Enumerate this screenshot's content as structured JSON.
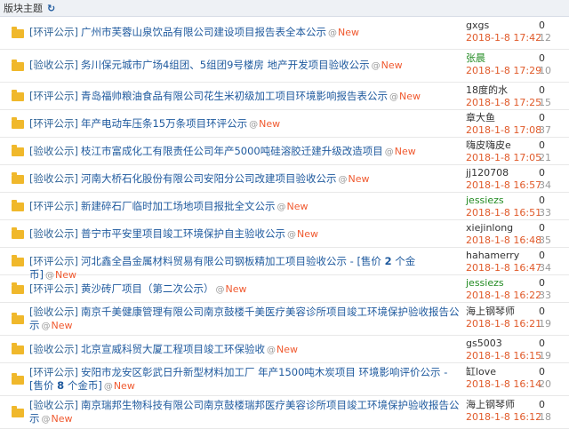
{
  "header": {
    "title": "版块主题",
    "refresh_icon": "refresh-icon"
  },
  "threads": [
    {
      "tag": "[环评公示]",
      "title": "广州市芙蓉山泉饮品有限公司建设项目报告表全本公示",
      "new": "New",
      "author": "gxgs",
      "author_green": false,
      "date": "2018-1-8 17:42",
      "replies": "0",
      "views": "12",
      "size": "tall",
      "lines": 1
    },
    {
      "tag": "[验收公示]",
      "title": "务川保元城市广场4组团、5组团9号楼房 地产开发项目验收公示",
      "new": "New",
      "author": "张晨",
      "author_green": true,
      "date": "2018-1-8 17:29",
      "replies": "0",
      "views": "10",
      "size": "tall",
      "lines": 1
    },
    {
      "tag": "[环评公示]",
      "title": "青岛福帅粮油食品有限公司花生米初级加工项目环境影响报告表公示",
      "new": "New",
      "author": "18度的水",
      "author_green": false,
      "date": "2018-1-8 17:25",
      "replies": "0",
      "views": "15",
      "size": "short",
      "lines": 1
    },
    {
      "tag": "[环评公示]",
      "title": "年产电动车压条15万条项目环评公示",
      "new": "New",
      "author": "章大鱼",
      "author_green": false,
      "date": "2018-1-8 17:08",
      "replies": "0",
      "views": "37",
      "size": "short",
      "lines": 1
    },
    {
      "tag": "[验收公示]",
      "title": "枝江市富成化工有限责任公司年产5000吨硅溶胶迁建升级改造项目",
      "new": "New",
      "author": "嗨皮嗨皮e",
      "author_green": false,
      "date": "2018-1-8 17:05",
      "replies": "0",
      "views": "21",
      "size": "short",
      "lines": 1
    },
    {
      "tag": "[验收公示]",
      "title": "河南大桥石化股份有限公司安阳分公司改建项目验收公示",
      "new": "New",
      "author": "jj120708",
      "author_green": false,
      "date": "2018-1-8 16:57",
      "replies": "0",
      "views": "34",
      "size": "short",
      "lines": 1
    },
    {
      "tag": "[环评公示]",
      "title": "新建碎石厂临时加工场地项目报批全文公示",
      "new": "New",
      "author": "jessiezs",
      "author_green": true,
      "date": "2018-1-8 16:51",
      "replies": "0",
      "views": "33",
      "size": "short",
      "lines": 1
    },
    {
      "tag": "[验收公示]",
      "title": "普宁市平安里项目竣工环境保护自主验收公示",
      "new": "New",
      "author": "xiejinlong",
      "author_green": false,
      "date": "2018-1-8 16:48",
      "replies": "0",
      "views": "35",
      "size": "short",
      "lines": 1
    },
    {
      "tag": "[环评公示]",
      "title": "河北鑫全昌金属材料贸易有限公司钢板精加工项目验收公示",
      "price_label": " - [售价 ",
      "price_value": "2",
      "price_unit": " 个金币]",
      "new": "New",
      "author": "hahamerry",
      "author_green": false,
      "date": "2018-1-8 16:47",
      "replies": "0",
      "views": "34",
      "size": "short",
      "lines": 1
    },
    {
      "tag": "[环评公示]",
      "title": "黄沙砖厂项目（第二次公示）",
      "new": "New",
      "author": "jessiezs",
      "author_green": true,
      "date": "2018-1-8 16:22",
      "replies": "0",
      "views": "33",
      "size": "short",
      "lines": 1
    },
    {
      "tag": "[验收公示]",
      "title": "南京千美健康管理有限公司南京鼓楼千美医疗美容诊所项目竣工环境保护验收报告公示",
      "new": "New",
      "author": "海上钢琴师",
      "author_green": false,
      "date": "2018-1-8 16:21",
      "replies": "0",
      "views": "19",
      "size": "tall",
      "lines": 2
    },
    {
      "tag": "[验收公示]",
      "title": "北京宣威科贸大厦工程项目竣工环保验收",
      "new": "New",
      "author": "gs5003",
      "author_green": false,
      "date": "2018-1-8 16:15",
      "replies": "0",
      "views": "19",
      "size": "short",
      "lines": 1
    },
    {
      "tag": "[环评公示]",
      "title": "安阳市龙安区彰武日升新型材料加工厂 年产1500吨木炭项目 环境影响评价公示",
      "price_label": " - [售价 ",
      "price_value": "8",
      "price_unit": " 个金币]",
      "new": "New",
      "author": "缸love",
      "author_green": false,
      "date": "2018-1-8 16:14",
      "replies": "0",
      "views": "20",
      "size": "tall",
      "lines": 2
    },
    {
      "tag": "[验收公示]",
      "title": "南京瑞邦生物科技有限公司南京鼓楼瑞邦医疗美容诊所项目竣工环境保护验收报告公示",
      "new": "New",
      "author": "海上钢琴师",
      "author_green": false,
      "date": "2018-1-8 16:12",
      "replies": "0",
      "views": "18",
      "size": "tall",
      "lines": 2
    }
  ]
}
